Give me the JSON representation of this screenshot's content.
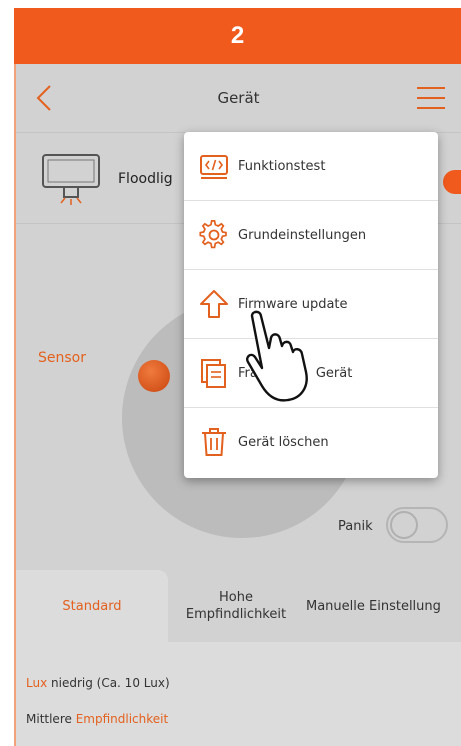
{
  "step": {
    "number": "2"
  },
  "appbar": {
    "title": "Gerät"
  },
  "device": {
    "name": "Floodlig"
  },
  "sensor": {
    "label": "Sensor"
  },
  "panik": {
    "label": "Panik",
    "enabled": false
  },
  "tabs": [
    {
      "label": "Standard",
      "active": true
    },
    {
      "label": "Hohe\nEmpfindlichkeit",
      "active": false
    },
    {
      "label": "Manuelle Einstellung",
      "active": false
    }
  ],
  "info": {
    "line1_highlight": "Lux",
    "line1_rest": " niedrig (Ca. 10 Lux)",
    "line2_rest": "Mittlere ",
    "line2_highlight": "Empfindlichkeit"
  },
  "menu": {
    "items": [
      {
        "label": "Funktionstest",
        "icon": "function-test-icon"
      },
      {
        "label": "Grundeinstellungen",
        "icon": "settings-gear-icon"
      },
      {
        "label": "Firmware update",
        "icon": "upload-arrow-icon"
      },
      {
        "label": "Fra",
        "label_suffix": "Gerät",
        "icon": "document-copy-icon"
      },
      {
        "label": "Gerät löschen",
        "icon": "trash-icon"
      }
    ]
  },
  "colors": {
    "accent": "#f15a1d",
    "background": "#d2d2d2"
  }
}
